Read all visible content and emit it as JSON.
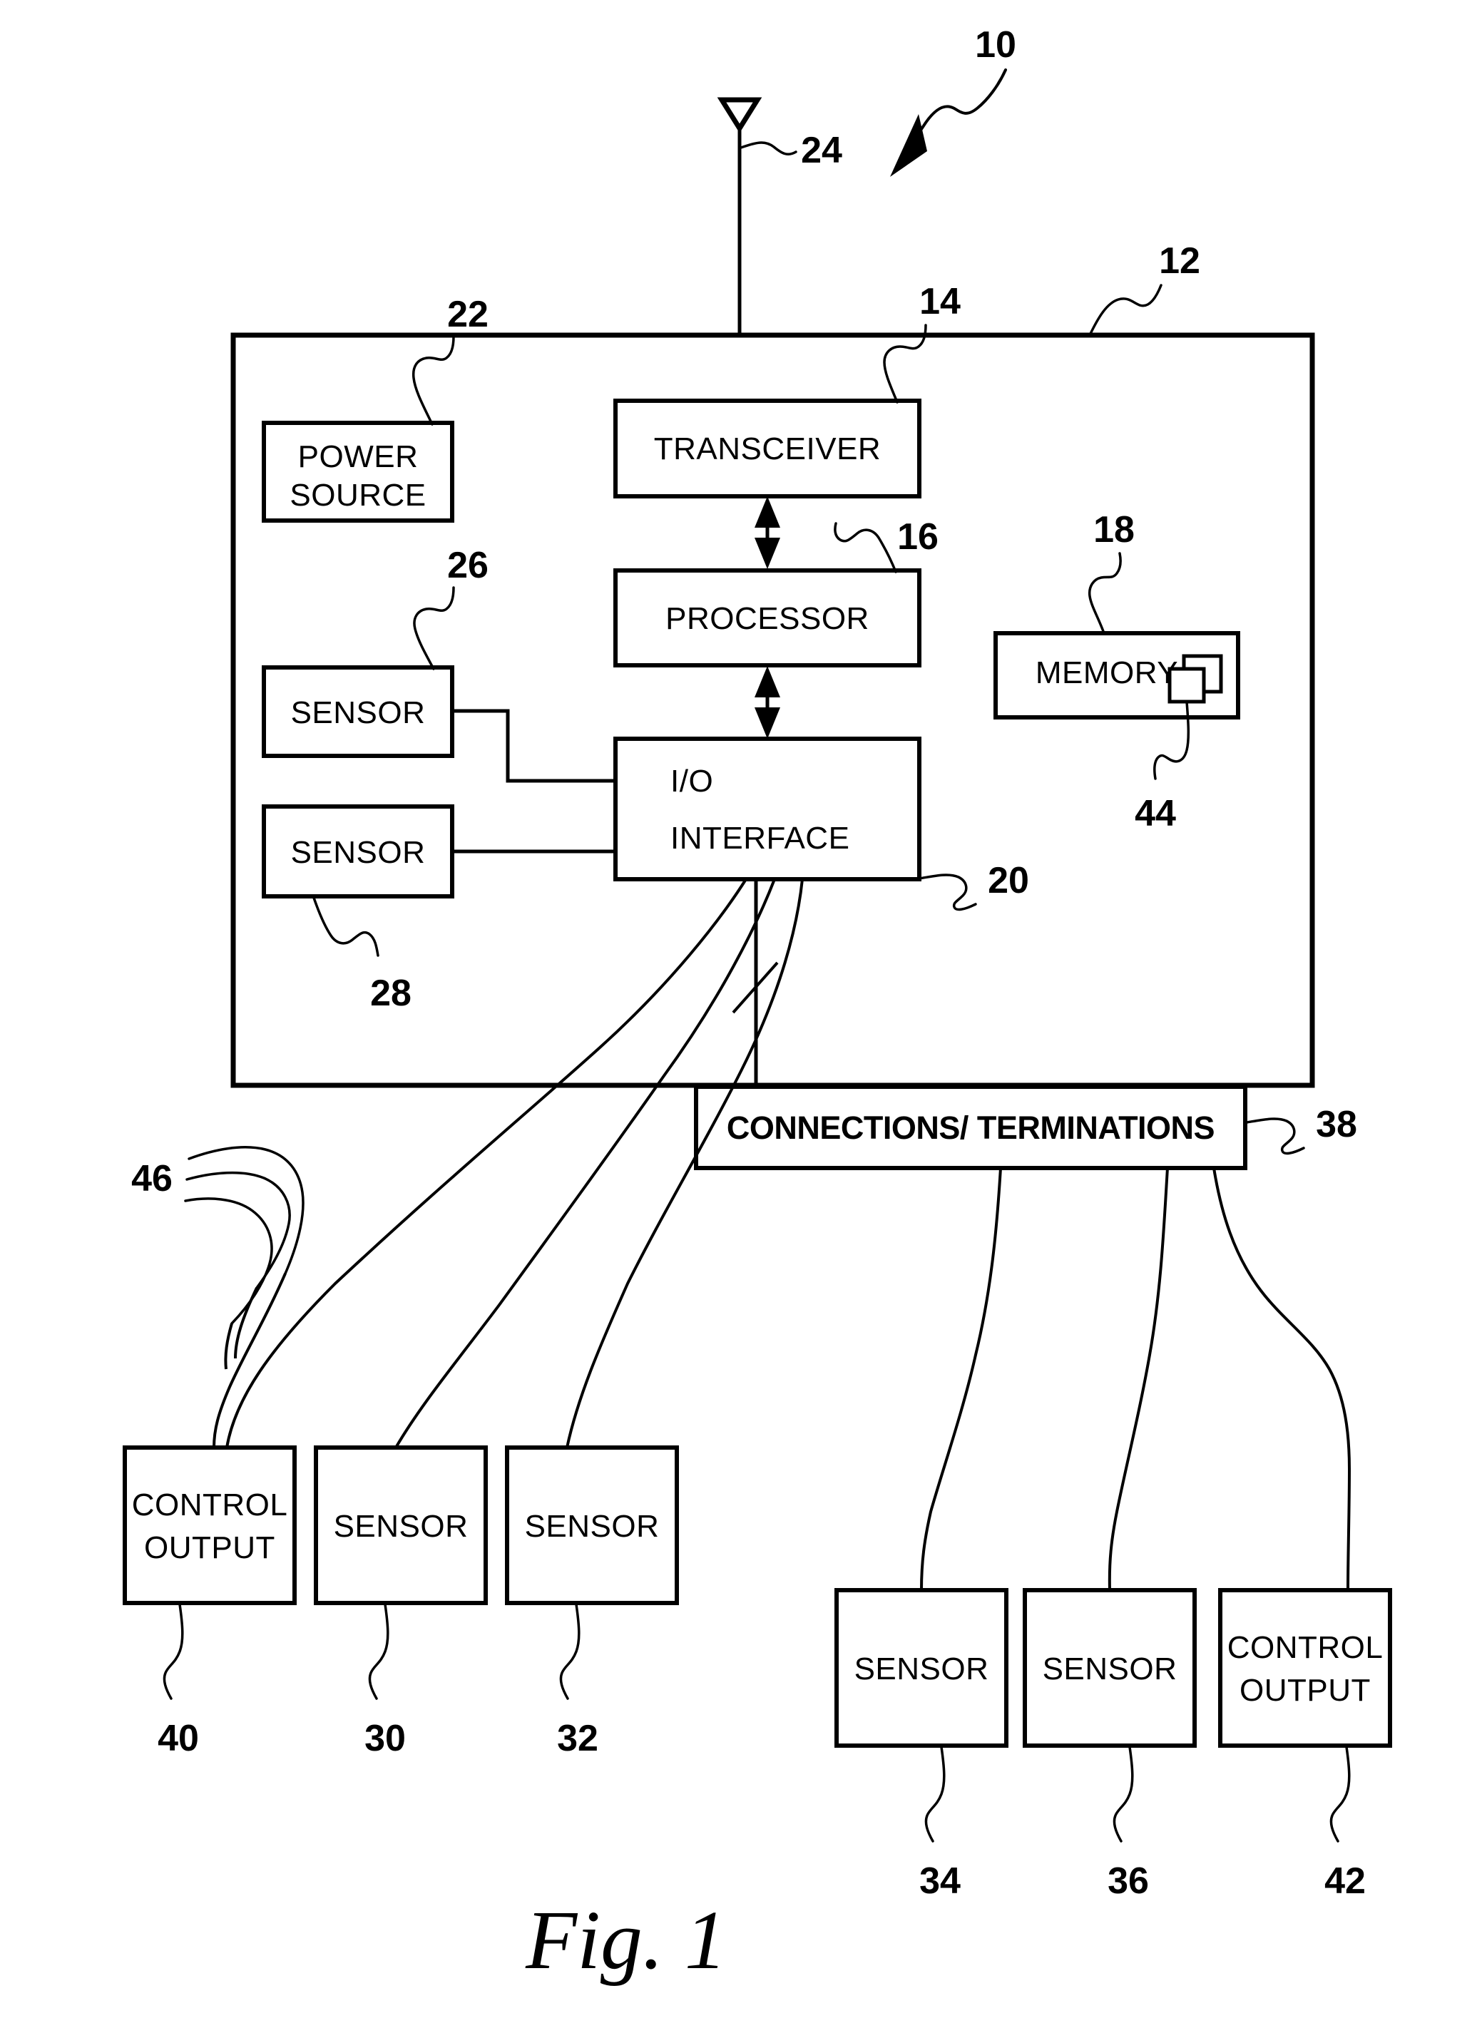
{
  "figure": {
    "caption": "Fig. 1",
    "system_ref": "10"
  },
  "enclosure": {
    "name": "device-enclosure",
    "ref": "12"
  },
  "antenna": {
    "name": "antenna",
    "ref": "24"
  },
  "blocks": [
    {
      "id": "power-source",
      "label_line1": "POWER",
      "label_line2": "SOURCE",
      "ref": "22"
    },
    {
      "id": "transceiver",
      "label_line1": "TRANSCEIVER",
      "label_line2": "",
      "ref": "14"
    },
    {
      "id": "processor",
      "label_line1": "PROCESSOR",
      "label_line2": "",
      "ref": "16"
    },
    {
      "id": "memory",
      "label_line1": "MEMORY",
      "label_line2": "",
      "ref": "18"
    },
    {
      "id": "memory-contents",
      "label_line1": "",
      "label_line2": "",
      "ref": "44"
    },
    {
      "id": "sensor-internal-1",
      "label_line1": "SENSOR",
      "label_line2": "",
      "ref": "26"
    },
    {
      "id": "sensor-internal-2",
      "label_line1": "SENSOR",
      "label_line2": "",
      "ref": "28"
    },
    {
      "id": "io-interface",
      "label_line1": "I/O",
      "label_line2": "INTERFACE",
      "ref": "20"
    },
    {
      "id": "connections-terminations",
      "label_line1": "CONNECTIONS/ TERMINATIONS",
      "label_line2": "",
      "ref": "38"
    },
    {
      "id": "control-output-left",
      "label_line1": "CONTROL",
      "label_line2": "OUTPUT",
      "ref": "40"
    },
    {
      "id": "sensor-external-1",
      "label_line1": "SENSOR",
      "label_line2": "",
      "ref": "30"
    },
    {
      "id": "sensor-external-2",
      "label_line1": "SENSOR",
      "label_line2": "",
      "ref": "32"
    },
    {
      "id": "sensor-external-3",
      "label_line1": "SENSOR",
      "label_line2": "",
      "ref": "34"
    },
    {
      "id": "sensor-external-4",
      "label_line1": "SENSOR",
      "label_line2": "",
      "ref": "36"
    },
    {
      "id": "control-output-right",
      "label_line1": "CONTROL",
      "label_line2": "OUTPUT",
      "ref": "42"
    }
  ],
  "wires": {
    "bundle_ref": "46"
  },
  "labels": {
    "power_source_l1": "POWER",
    "power_source_l2": "SOURCE",
    "transceiver": "TRANSCEIVER",
    "processor": "PROCESSOR",
    "memory": "MEMORY",
    "sensor": "SENSOR",
    "io_l1": "I/O",
    "io_l2": "INTERFACE",
    "connections": "CONNECTIONS/ TERMINATIONS",
    "control_l1": "CONTROL",
    "control_l2": "OUTPUT"
  },
  "refs": {
    "r10": "10",
    "r12": "12",
    "r14": "14",
    "r16": "16",
    "r18": "18",
    "r20": "20",
    "r22": "22",
    "r24": "24",
    "r26": "26",
    "r28": "28",
    "r30": "30",
    "r32": "32",
    "r34": "34",
    "r36": "36",
    "r38": "38",
    "r40": "40",
    "r42": "42",
    "r44": "44",
    "r46": "46"
  },
  "colors": {
    "ink": "#000000",
    "paper": "#ffffff"
  }
}
